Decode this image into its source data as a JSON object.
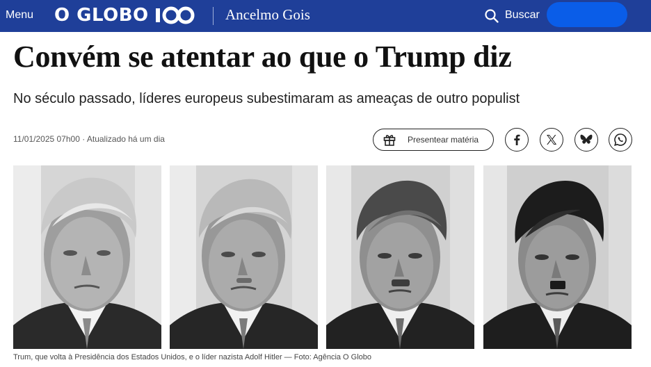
{
  "header": {
    "menu_label": "Menu",
    "logo_text": "O GLOBO",
    "logo_badge": "100",
    "column_name": "Ancelmo Gois",
    "search_label": "Buscar",
    "brand_color": "#1f3f99",
    "accent_color": "#0a5de8"
  },
  "article": {
    "headline": "Convém se atentar ao que o Trump diz",
    "subtitle": "No século passado, líderes europeus subestimaram as ameaças de outro populist",
    "dateline": "11/01/2025 07h00 · Atualizado há um dia",
    "gift_label": "Presentear matéria",
    "share_icons": [
      "facebook-icon",
      "x-icon",
      "bluesky-icon",
      "whatsapp-icon"
    ],
    "caption": "Trum, que volta à Presidência dos Estados Unidos, e o líder nazista Adolf Hitler — Foto: Agência O Globo"
  }
}
